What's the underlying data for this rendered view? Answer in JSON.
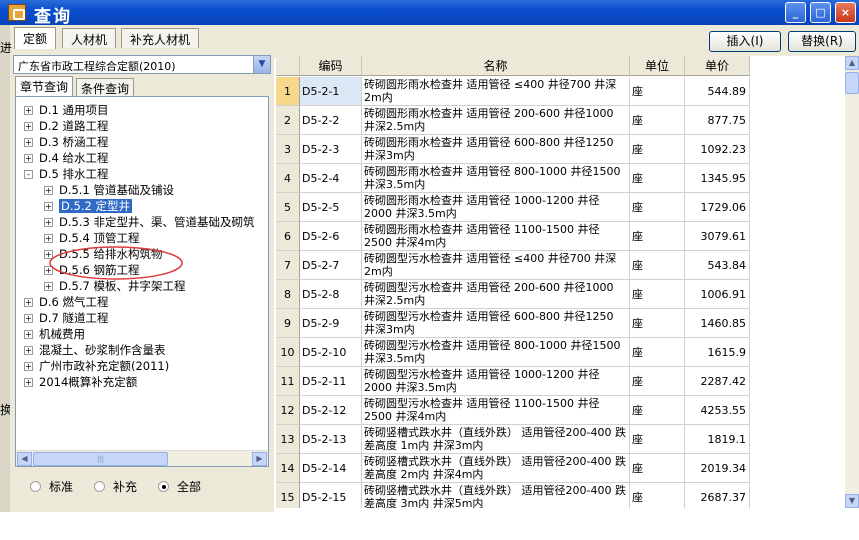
{
  "window": {
    "title": "查询"
  },
  "tabs": [
    "定额",
    "人材机",
    "补充人材机"
  ],
  "buttons": {
    "insert": "插入(I)",
    "replace": "替换(R)"
  },
  "edge_fragments": {
    "top": "进",
    "bottom": "换"
  },
  "quota_book": "广东省市政工程综合定额(2010)",
  "subtabs": [
    "章节查询",
    "条件查询"
  ],
  "tree": [
    {
      "label": "D.1 通用项目",
      "level": 0,
      "expander": "+"
    },
    {
      "label": "D.2 道路工程",
      "level": 0,
      "expander": "+"
    },
    {
      "label": "D.3 桥涵工程",
      "level": 0,
      "expander": "+"
    },
    {
      "label": "D.4 给水工程",
      "level": 0,
      "expander": "+"
    },
    {
      "label": "D.5 排水工程",
      "level": 0,
      "expander": "-"
    },
    {
      "label": "D.5.1 管道基础及铺设",
      "level": 1,
      "expander": "+"
    },
    {
      "label": "D.5.2 定型井",
      "level": 1,
      "expander": "+",
      "selected": true
    },
    {
      "label": "D.5.3 非定型井、渠、管道基础及砌筑",
      "level": 1,
      "expander": "+"
    },
    {
      "label": "D.5.4 顶管工程",
      "level": 1,
      "expander": "+"
    },
    {
      "label": "D.5.5 给排水构筑物",
      "level": 1,
      "expander": "+"
    },
    {
      "label": "D.5.6 钢筋工程",
      "level": 1,
      "expander": "+"
    },
    {
      "label": "D.5.7 模板、井字架工程",
      "level": 1,
      "expander": "+"
    },
    {
      "label": "D.6 燃气工程",
      "level": 0,
      "expander": "+"
    },
    {
      "label": "D.7 隧道工程",
      "level": 0,
      "expander": "+"
    },
    {
      "label": "机械费用",
      "level": 0,
      "expander": "+"
    },
    {
      "label": "混凝土、砂浆制作含量表",
      "level": 0,
      "expander": "+"
    },
    {
      "label": "广州市政补充定额(2011)",
      "level": 0,
      "expander": "+"
    },
    {
      "label": "2014概算补充定额",
      "level": 0,
      "expander": "+"
    }
  ],
  "filter": {
    "options": [
      "标准",
      "补充",
      "全部"
    ],
    "selected": "全部"
  },
  "grid": {
    "headers": [
      "编码",
      "名称",
      "单位",
      "单价"
    ],
    "rows": [
      {
        "n": "1",
        "code": "D5-2-1",
        "name": "砖砌圆形雨水检查井 适用管径 ≤400 井径700 井深2m内",
        "unit": "座",
        "price": "544.89"
      },
      {
        "n": "2",
        "code": "D5-2-2",
        "name": "砖砌圆形雨水检查井 适用管径 200-600 井径1000 井深2.5m内",
        "unit": "座",
        "price": "877.75"
      },
      {
        "n": "3",
        "code": "D5-2-3",
        "name": "砖砌圆形雨水检查井 适用管径 600-800 井径1250 井深3m内",
        "unit": "座",
        "price": "1092.23"
      },
      {
        "n": "4",
        "code": "D5-2-4",
        "name": "砖砌圆形雨水检查井 适用管径 800-1000 井径1500 井深3.5m内",
        "unit": "座",
        "price": "1345.95"
      },
      {
        "n": "5",
        "code": "D5-2-5",
        "name": "砖砌圆形雨水检查井 适用管径 1000-1200 井径2000 井深3.5m内",
        "unit": "座",
        "price": "1729.06"
      },
      {
        "n": "6",
        "code": "D5-2-6",
        "name": "砖砌圆形雨水检查井 适用管径 1100-1500 井径2500 井深4m内",
        "unit": "座",
        "price": "3079.61"
      },
      {
        "n": "7",
        "code": "D5-2-7",
        "name": "砖砌圆型污水检查井 适用管径 ≤400 井径700 井深2m内",
        "unit": "座",
        "price": "543.84"
      },
      {
        "n": "8",
        "code": "D5-2-8",
        "name": "砖砌圆型污水检查井 适用管径 200-600 井径1000 井深2.5m内",
        "unit": "座",
        "price": "1006.91"
      },
      {
        "n": "9",
        "code": "D5-2-9",
        "name": "砖砌圆型污水检查井 适用管径 600-800 井径1250 井深3m内",
        "unit": "座",
        "price": "1460.85"
      },
      {
        "n": "10",
        "code": "D5-2-10",
        "name": "砖砌圆型污水检查井 适用管径 800-1000 井径1500 井深3.5m内",
        "unit": "座",
        "price": "1615.9"
      },
      {
        "n": "11",
        "code": "D5-2-11",
        "name": "砖砌圆型污水检查井 适用管径 1000-1200 井径2000 井深3.5m内",
        "unit": "座",
        "price": "2287.42"
      },
      {
        "n": "12",
        "code": "D5-2-12",
        "name": "砖砌圆型污水检查井 适用管径 1100-1500 井径2500 井深4m内",
        "unit": "座",
        "price": "4253.55"
      },
      {
        "n": "13",
        "code": "D5-2-13",
        "name": "砖砌竖槽式跌水井（直线外跌） 适用管径200-400 跌差高度 1m内 井深3m内",
        "unit": "座",
        "price": "1819.1"
      },
      {
        "n": "14",
        "code": "D5-2-14",
        "name": "砖砌竖槽式跌水井（直线外跌） 适用管径200-400 跌差高度 2m内 井深4m内",
        "unit": "座",
        "price": "2019.34"
      },
      {
        "n": "15",
        "code": "D5-2-15",
        "name": "砖砌竖槽式跌水井（直线外跌） 适用管径200-400 跌差高度 3m内 井深5m内",
        "unit": "座",
        "price": "2687.37"
      }
    ]
  }
}
